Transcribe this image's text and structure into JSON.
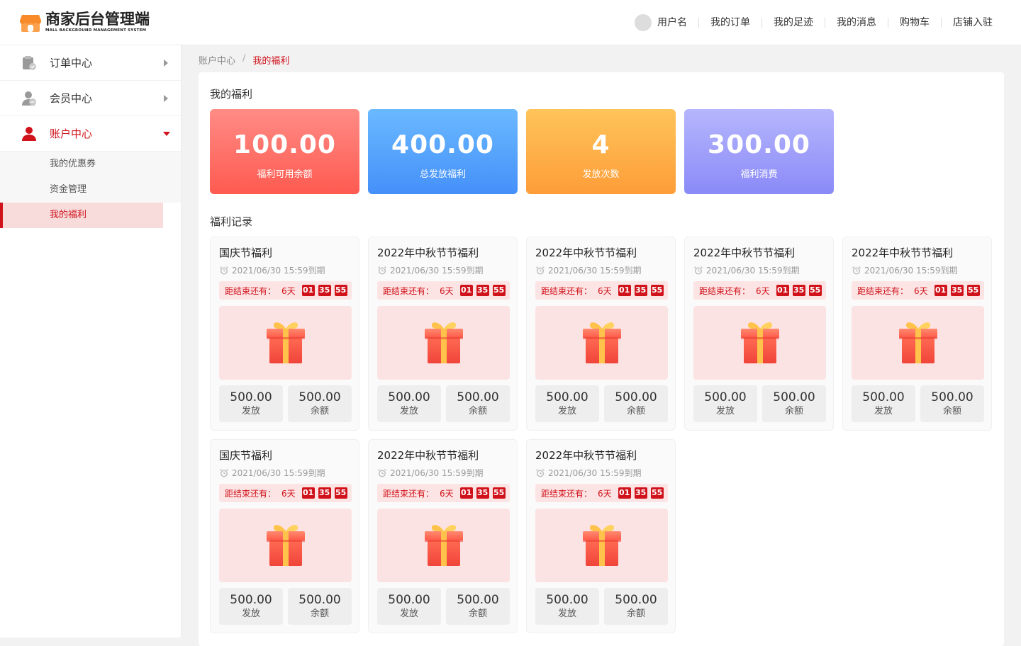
{
  "header": {
    "logo_title": "商家后台管理端",
    "logo_subtitle": "MALL BACKGROUND MANAGEMENT SYSTEM",
    "username": "用户名",
    "nav": [
      "我的订单",
      "我的足迹",
      "我的消息",
      "购物车",
      "店铺入驻"
    ]
  },
  "sidebar": {
    "groups": [
      {
        "label": "订单中心",
        "icon": "order-icon",
        "expanded": false
      },
      {
        "label": "会员中心",
        "icon": "member-icon",
        "expanded": false
      },
      {
        "label": "账户中心",
        "icon": "account-icon",
        "expanded": true,
        "active": true
      }
    ],
    "subitems": [
      "我的优惠券",
      "资金管理",
      "我的福利"
    ],
    "active_subitem": "我的福利"
  },
  "breadcrumb": {
    "parent": "账户中心",
    "separator": "/",
    "current": "我的福利"
  },
  "page": {
    "title": "我的福利",
    "records_title": "福利记录"
  },
  "stats": [
    {
      "value": "100.00",
      "label": "福利可用余额",
      "color": "#fe5a50"
    },
    {
      "value": "400.00",
      "label": "总发放福利",
      "color": "#4590f9"
    },
    {
      "value": "4",
      "label": "发放次数",
      "color": "#fd9d38"
    },
    {
      "value": "300.00",
      "label": "福利消费",
      "color": "#8a8af8"
    }
  ],
  "countdown_label": "距结束还有：",
  "amount_labels": {
    "issued": "发放",
    "balance": "余额"
  },
  "records": [
    {
      "title": "国庆节福利",
      "expiry": "2021/06/30 15:59到期",
      "days": "6天",
      "hours": "01",
      "minutes": "35",
      "seconds": "55",
      "issued": "500.00",
      "balance": "500.00"
    },
    {
      "title": "2022年中秋节节福利",
      "expiry": "2021/06/30 15:59到期",
      "days": "6天",
      "hours": "01",
      "minutes": "35",
      "seconds": "55",
      "issued": "500.00",
      "balance": "500.00"
    },
    {
      "title": "2022年中秋节节福利",
      "expiry": "2021/06/30 15:59到期",
      "days": "6天",
      "hours": "01",
      "minutes": "35",
      "seconds": "55",
      "issued": "500.00",
      "balance": "500.00"
    },
    {
      "title": "2022年中秋节节福利",
      "expiry": "2021/06/30 15:59到期",
      "days": "6天",
      "hours": "01",
      "minutes": "35",
      "seconds": "55",
      "issued": "500.00",
      "balance": "500.00"
    },
    {
      "title": "2022年中秋节节福利",
      "expiry": "2021/06/30 15:59到期",
      "days": "6天",
      "hours": "01",
      "minutes": "35",
      "seconds": "55",
      "issued": "500.00",
      "balance": "500.00"
    },
    {
      "title": "国庆节福利",
      "expiry": "2021/06/30 15:59到期",
      "days": "6天",
      "hours": "01",
      "minutes": "35",
      "seconds": "55",
      "issued": "500.00",
      "balance": "500.00"
    },
    {
      "title": "2022年中秋节节福利",
      "expiry": "2021/06/30 15:59到期",
      "days": "6天",
      "hours": "01",
      "minutes": "35",
      "seconds": "55",
      "issued": "500.00",
      "balance": "500.00"
    },
    {
      "title": "2022年中秋节节福利",
      "expiry": "2021/06/30 15:59到期",
      "days": "6天",
      "hours": "01",
      "minutes": "35",
      "seconds": "55",
      "issued": "500.00",
      "balance": "500.00"
    }
  ],
  "colors": {
    "accent": "#d0121b",
    "logo_orange": "#f98a2a"
  }
}
